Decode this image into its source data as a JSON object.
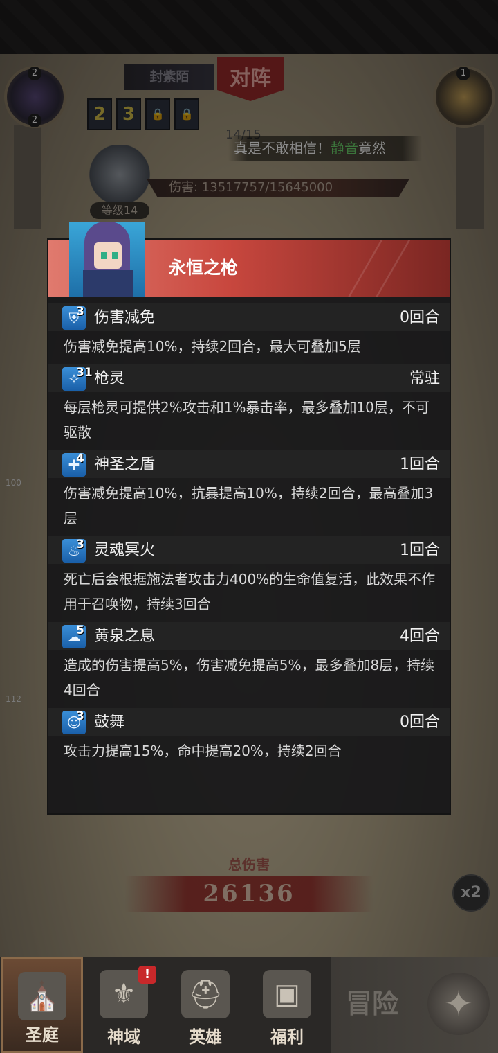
{
  "top": {
    "left_badge_top": "2",
    "left_badge_bottom": "2",
    "right_badge": "1",
    "opponent_name": "封紫陌",
    "vs_label": "对阵",
    "slots": [
      "2",
      "3",
      "🔒",
      "🔒"
    ],
    "progress": "14/15",
    "chat_prefix": "真是不敢相信！",
    "chat_highlight": "静音",
    "chat_suffix": "竟然",
    "damage": "伤害: 13517757/15645000",
    "boss_level": "等级14"
  },
  "side": {
    "hp1": "100",
    "hp2": "112"
  },
  "panel": {
    "hero_name": "永恒之枪",
    "buffs": [
      {
        "icon": "shield-down-icon",
        "stack": "3",
        "name": "伤害减免",
        "duration": "0回合",
        "desc": "伤害减免提高10%，持续2回合，最大可叠加5层"
      },
      {
        "icon": "spear-spirit-icon",
        "stack": "31",
        "name": "枪灵",
        "duration": "常驻",
        "desc": "每层枪灵可提供2%攻击和1%暴击率，最多叠加10层，不可驱散"
      },
      {
        "icon": "holy-shield-icon",
        "stack": "4",
        "name": "神圣之盾",
        "duration": "1回合",
        "desc": "伤害减免提高10%，抗暴提高10%，持续2回合，最高叠加3层"
      },
      {
        "icon": "soul-fire-icon",
        "stack": "3",
        "name": "灵魂冥火",
        "duration": "1回合",
        "desc": "死亡后会根据施法者攻击力400%的生命值复活，此效果不作用于召唤物，持续3回合"
      },
      {
        "icon": "underworld-breath-icon",
        "stack": "5",
        "name": "黄泉之息",
        "duration": "4回合",
        "desc": "造成的伤害提高5%，伤害减免提高5%，最多叠加8层，持续4回合"
      },
      {
        "icon": "inspire-icon",
        "stack": "3",
        "name": "鼓舞",
        "duration": "0回合",
        "desc": "攻击力提高15%，命中提高20%，持续2回合"
      }
    ]
  },
  "battle": {
    "total_label": "总伤害",
    "total_value": "26136",
    "speed": "x2"
  },
  "nav": {
    "items": [
      {
        "label": "圣庭",
        "icon": "temple-icon"
      },
      {
        "label": "神域",
        "icon": "divine-realm-icon"
      },
      {
        "label": "英雄",
        "icon": "hero-helmet-icon"
      },
      {
        "label": "福利",
        "icon": "treasure-chest-icon"
      }
    ],
    "adventure": "冒险"
  }
}
